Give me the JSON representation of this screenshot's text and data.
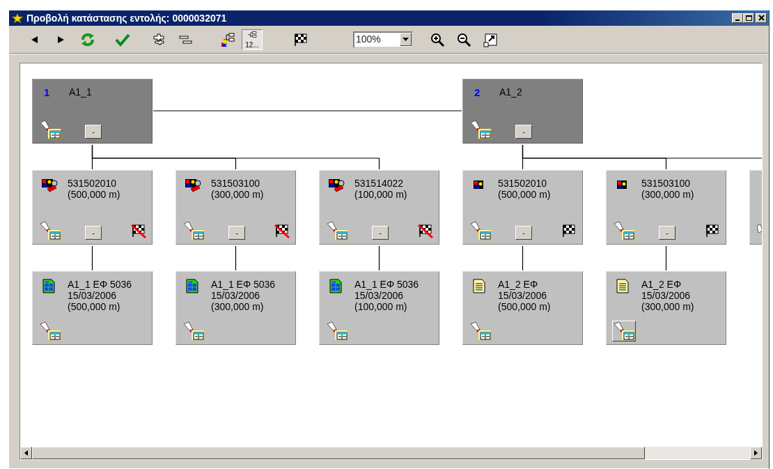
{
  "window": {
    "title": "Προβολή κατάστασης εντολής: 0000032071"
  },
  "toolbar": [
    {
      "kind": "back",
      "selected": false
    },
    {
      "kind": "forward",
      "selected": false
    },
    {
      "kind": "refresh",
      "selected": false
    },
    {
      "kind": "confirm",
      "selected": false
    },
    {
      "kind": "expand",
      "selected": false
    },
    {
      "kind": "collapse",
      "selected": false
    },
    {
      "kind": "tree_colored",
      "selected": false
    },
    {
      "kind": "tree_numbered",
      "caption": "12...",
      "selected": true
    },
    {
      "kind": "flag",
      "selected": false
    },
    {
      "kind": "zoom_select",
      "value": "100%"
    },
    {
      "kind": "zoom_in",
      "selected": false
    },
    {
      "kind": "zoom_out",
      "selected": false
    },
    {
      "kind": "fit",
      "selected": false
    }
  ],
  "diagram": {
    "roots": [
      {
        "number": "1",
        "label": "A1_1",
        "toggle": "-",
        "children": [
          {
            "kind": "tagged_item",
            "code": "531502010",
            "quantity": "(500,000 m)",
            "toggle": "-",
            "flag_crossed": true,
            "children": [
              {
                "kind": "sheet",
                "lines": [
                  "A1_1 ΕΦ 5036",
                  "15/03/2006",
                  "(500,000 m)"
                ],
                "viewer_raised": false
              }
            ]
          },
          {
            "kind": "tagged_item",
            "code": "531503100",
            "quantity": "(300,000 m)",
            "toggle": "-",
            "flag_crossed": true,
            "children": [
              {
                "kind": "sheet",
                "lines": [
                  "A1_1 ΕΦ 5036",
                  "15/03/2006",
                  "(300,000 m)"
                ],
                "viewer_raised": false
              }
            ]
          },
          {
            "kind": "tagged_item",
            "code": "531514022",
            "quantity": "(100,000 m)",
            "toggle": "-",
            "flag_crossed": true,
            "children": [
              {
                "kind": "sheet",
                "lines": [
                  "A1_1 ΕΦ 5036",
                  "15/03/2006",
                  "(100,000 m)"
                ],
                "viewer_raised": false
              }
            ]
          }
        ]
      },
      {
        "number": "2",
        "label": "A1_2",
        "toggle": "-",
        "children": [
          {
            "kind": "item",
            "code": "531502010",
            "quantity": "(500,000 m)",
            "toggle": "-",
            "flag_crossed": false,
            "children": [
              {
                "kind": "page",
                "lines": [
                  "A1_2 ΕΦ",
                  "15/03/2006",
                  "(500,000 m)"
                ],
                "viewer_raised": false
              }
            ]
          },
          {
            "kind": "item",
            "code": "531503100",
            "quantity": "(300,000 m)",
            "toggle": "-",
            "flag_crossed": false,
            "children": [
              {
                "kind": "page",
                "lines": [
                  "A1_2 ΕΦ",
                  "15/03/2006",
                  "(300,000 m)"
                ],
                "viewer_raised": true
              }
            ]
          },
          {
            "kind": "clipped"
          }
        ]
      }
    ]
  }
}
